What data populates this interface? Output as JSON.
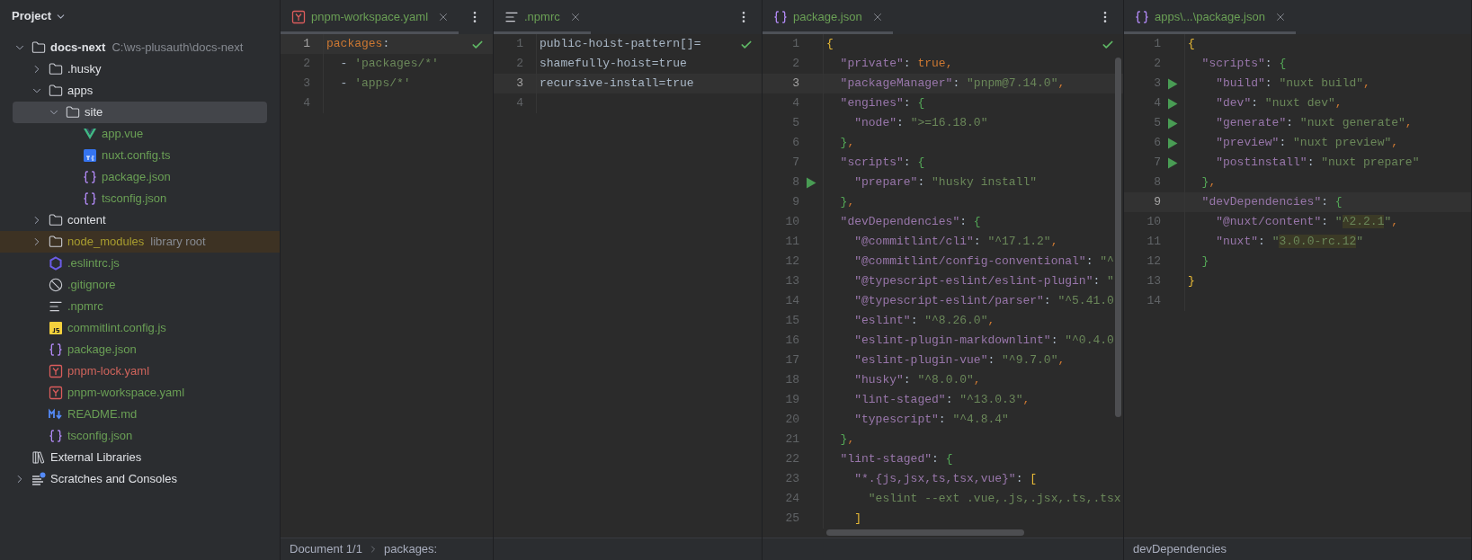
{
  "sidebar": {
    "title": "Project",
    "tree": [
      {
        "label": "docs-next",
        "kind": "folder",
        "bold": true,
        "hint": "C:\\ws-plusauth\\docs-next",
        "expanded": true,
        "selected": false,
        "color": "#dfe1e5",
        "children": [
          {
            "label": ".husky",
            "kind": "folder",
            "expanded": false,
            "selected": false,
            "color": "#dfe1e5"
          },
          {
            "label": "apps",
            "kind": "folder",
            "expanded": true,
            "selected": false,
            "color": "#dfe1e5",
            "children": [
              {
                "label": "site",
                "kind": "folder",
                "expanded": true,
                "selected": true,
                "color": "#dfe1e5",
                "children": [
                  {
                    "label": "app.vue",
                    "kind": "vue",
                    "selected": false,
                    "color": "#6a9f55"
                  },
                  {
                    "label": "nuxt.config.ts",
                    "kind": "ts",
                    "selected": false,
                    "color": "#6a9f55"
                  },
                  {
                    "label": "package.json",
                    "kind": "json",
                    "selected": false,
                    "color": "#6a9f55"
                  },
                  {
                    "label": "tsconfig.json",
                    "kind": "json",
                    "selected": false,
                    "color": "#6a9f55"
                  }
                ]
              }
            ]
          },
          {
            "label": "content",
            "kind": "folder",
            "expanded": false,
            "selected": false,
            "color": "#dfe1e5"
          },
          {
            "label": "node_modules",
            "kind": "library-folder",
            "hint": "library root",
            "expanded": false,
            "selected": false,
            "color": "#a89d2f"
          },
          {
            "label": ".eslintrc.js",
            "kind": "eslint",
            "selected": false,
            "color": "#6a9f55"
          },
          {
            "label": ".gitignore",
            "kind": "ignore",
            "selected": false,
            "color": "#6a9f55"
          },
          {
            "label": ".npmrc",
            "kind": "text",
            "selected": false,
            "color": "#6a9f55"
          },
          {
            "label": "commitlint.config.js",
            "kind": "js",
            "selected": false,
            "color": "#6a9f55"
          },
          {
            "label": "package.json",
            "kind": "json",
            "selected": false,
            "color": "#6a9f55"
          },
          {
            "label": "pnpm-lock.yaml",
            "kind": "yaml",
            "selected": false,
            "color": "#d0645c"
          },
          {
            "label": "pnpm-workspace.yaml",
            "kind": "yaml",
            "selected": false,
            "color": "#6a9f55"
          },
          {
            "label": "README.md",
            "kind": "markdown",
            "selected": false,
            "color": "#6a9f55"
          },
          {
            "label": "tsconfig.json",
            "kind": "json",
            "selected": false,
            "color": "#6a9f55"
          }
        ]
      },
      {
        "label": "External Libraries",
        "kind": "libraries",
        "selected": false,
        "color": "#dfe1e5"
      },
      {
        "label": "Scratches and Consoles",
        "kind": "scratches",
        "expanded": false,
        "selected": false,
        "color": "#dfe1e5"
      }
    ]
  },
  "editors": [
    {
      "tab": {
        "label": "pnpm-workspace.yaml",
        "kind": "yaml",
        "color": "#6a9f55",
        "selected": true
      },
      "menu_button": true,
      "inspection_ok": true,
      "lines": [
        {
          "n": "1",
          "current": true,
          "run": false,
          "tokens": [
            {
              "kind": "ykey",
              "text": "packages"
            },
            {
              "kind": "plain",
              "text": ":"
            }
          ]
        },
        {
          "n": "2",
          "current": false,
          "run": false,
          "tokens": [
            {
              "kind": "plain",
              "text": "  - "
            },
            {
              "kind": "str",
              "text": "'packages/*'"
            }
          ]
        },
        {
          "n": "3",
          "current": false,
          "run": false,
          "tokens": [
            {
              "kind": "plain",
              "text": "  - "
            },
            {
              "kind": "str",
              "text": "'apps/*'"
            }
          ]
        },
        {
          "n": "4",
          "current": false,
          "run": false
        }
      ],
      "breadcrumbs": [
        "Document 1/1",
        "packages:"
      ]
    },
    {
      "tab": {
        "label": ".npmrc",
        "kind": "text",
        "color": "#6a9f55",
        "selected": true
      },
      "menu_button": true,
      "inspection_ok": true,
      "lines": [
        {
          "n": "1",
          "current": false,
          "run": false,
          "tokens": [
            {
              "kind": "plain",
              "text": "public-hoist-pattern[]="
            }
          ]
        },
        {
          "n": "2",
          "current": false,
          "run": false,
          "tokens": [
            {
              "kind": "plain",
              "text": "shamefully-hoist=true"
            }
          ]
        },
        {
          "n": "3",
          "current": true,
          "run": false,
          "tokens": [
            {
              "kind": "plain",
              "text": "recursive-install=true"
            }
          ]
        },
        {
          "n": "4",
          "current": false,
          "run": false
        }
      ]
    },
    {
      "tab": {
        "label": "package.json",
        "kind": "json",
        "color": "#6a9f55",
        "selected": true
      },
      "menu_button": true,
      "inspection_ok": true,
      "lines": [
        {
          "n": "1",
          "current": false,
          "run": false,
          "tokens": [
            {
              "kind": "b1",
              "text": "{"
            }
          ]
        },
        {
          "n": "2",
          "current": false,
          "run": false,
          "tokens": [
            {
              "kind": "key",
              "text": "  \"private\""
            },
            {
              "kind": "plain",
              "text": ": "
            },
            {
              "kind": "kw",
              "text": "true"
            },
            {
              "kind": "kw",
              "text": ","
            }
          ]
        },
        {
          "n": "3",
          "current": true,
          "run": false,
          "tokens": [
            {
              "kind": "key",
              "text": "  \"packageManager\""
            },
            {
              "kind": "plain",
              "text": ": "
            },
            {
              "kind": "str",
              "text": "\"pnpm@7.14.0\""
            },
            {
              "kind": "kw",
              "text": ","
            }
          ]
        },
        {
          "n": "4",
          "current": false,
          "run": false,
          "tokens": [
            {
              "kind": "key",
              "text": "  \"engines\""
            },
            {
              "kind": "plain",
              "text": ": "
            },
            {
              "kind": "b2",
              "text": "{"
            }
          ]
        },
        {
          "n": "5",
          "current": false,
          "run": false,
          "tokens": [
            {
              "kind": "key",
              "text": "    \"node\""
            },
            {
              "kind": "plain",
              "text": ": "
            },
            {
              "kind": "str",
              "text": "\">=16.18.0\""
            }
          ]
        },
        {
          "n": "6",
          "current": false,
          "run": false,
          "tokens": [
            {
              "kind": "b2",
              "text": "  }"
            },
            {
              "kind": "kw",
              "text": ","
            }
          ]
        },
        {
          "n": "7",
          "current": false,
          "run": false,
          "tokens": [
            {
              "kind": "key",
              "text": "  \"scripts\""
            },
            {
              "kind": "plain",
              "text": ": "
            },
            {
              "kind": "b2",
              "text": "{"
            }
          ]
        },
        {
          "n": "8",
          "current": false,
          "run": true,
          "tokens": [
            {
              "kind": "key",
              "text": "    \"prepare\""
            },
            {
              "kind": "plain",
              "text": ": "
            },
            {
              "kind": "str",
              "text": "\"husky install\""
            }
          ]
        },
        {
          "n": "9",
          "current": false,
          "run": false,
          "tokens": [
            {
              "kind": "b2",
              "text": "  }"
            },
            {
              "kind": "kw",
              "text": ","
            }
          ]
        },
        {
          "n": "10",
          "current": false,
          "run": false,
          "tokens": [
            {
              "kind": "key",
              "text": "  \"devDependencies\""
            },
            {
              "kind": "plain",
              "text": ": "
            },
            {
              "kind": "b2",
              "text": "{"
            }
          ]
        },
        {
          "n": "11",
          "current": false,
          "run": false,
          "tokens": [
            {
              "kind": "key",
              "text": "    \"@commitlint/cli\""
            },
            {
              "kind": "plain",
              "text": ": "
            },
            {
              "kind": "str",
              "text": "\"^17.1.2\""
            },
            {
              "kind": "kw",
              "text": ","
            }
          ]
        },
        {
          "n": "12",
          "current": false,
          "run": false,
          "tokens": [
            {
              "kind": "key",
              "text": "    \"@commitlint/config-conventional\""
            },
            {
              "kind": "plain",
              "text": ": "
            },
            {
              "kind": "str",
              "text": "\"^"
            }
          ]
        },
        {
          "n": "13",
          "current": false,
          "run": false,
          "tokens": [
            {
              "kind": "key",
              "text": "    \"@typescript-eslint/eslint-plugin\""
            },
            {
              "kind": "plain",
              "text": ": "
            },
            {
              "kind": "str",
              "text": "\""
            }
          ]
        },
        {
          "n": "14",
          "current": false,
          "run": false,
          "tokens": [
            {
              "kind": "key",
              "text": "    \"@typescript-eslint/parser\""
            },
            {
              "kind": "plain",
              "text": ": "
            },
            {
              "kind": "str",
              "text": "\"^5.41.0"
            }
          ]
        },
        {
          "n": "15",
          "current": false,
          "run": false,
          "tokens": [
            {
              "kind": "key",
              "text": "    \"eslint\""
            },
            {
              "kind": "plain",
              "text": ": "
            },
            {
              "kind": "str",
              "text": "\"^8.26.0\""
            },
            {
              "kind": "kw",
              "text": ","
            }
          ]
        },
        {
          "n": "16",
          "current": false,
          "run": false,
          "tokens": [
            {
              "kind": "key",
              "text": "    \"eslint-plugin-markdownlint\""
            },
            {
              "kind": "plain",
              "text": ": "
            },
            {
              "kind": "str",
              "text": "\"^0.4.0"
            }
          ]
        },
        {
          "n": "17",
          "current": false,
          "run": false,
          "tokens": [
            {
              "kind": "key",
              "text": "    \"eslint-plugin-vue\""
            },
            {
              "kind": "plain",
              "text": ": "
            },
            {
              "kind": "str",
              "text": "\"^9.7.0\""
            },
            {
              "kind": "kw",
              "text": ","
            }
          ]
        },
        {
          "n": "18",
          "current": false,
          "run": false,
          "tokens": [
            {
              "kind": "key",
              "text": "    \"husky\""
            },
            {
              "kind": "plain",
              "text": ": "
            },
            {
              "kind": "str",
              "text": "\"^8.0.0\""
            },
            {
              "kind": "kw",
              "text": ","
            }
          ]
        },
        {
          "n": "19",
          "current": false,
          "run": false,
          "tokens": [
            {
              "kind": "key",
              "text": "    \"lint-staged\""
            },
            {
              "kind": "plain",
              "text": ": "
            },
            {
              "kind": "str",
              "text": "\"^13.0.3\""
            },
            {
              "kind": "kw",
              "text": ","
            }
          ]
        },
        {
          "n": "20",
          "current": false,
          "run": false,
          "tokens": [
            {
              "kind": "key",
              "text": "    \"typescript\""
            },
            {
              "kind": "plain",
              "text": ": "
            },
            {
              "kind": "str",
              "text": "\"^4.8.4\""
            }
          ]
        },
        {
          "n": "21",
          "current": false,
          "run": false,
          "tokens": [
            {
              "kind": "b2",
              "text": "  }"
            },
            {
              "kind": "kw",
              "text": ","
            }
          ]
        },
        {
          "n": "22",
          "current": false,
          "run": false,
          "tokens": [
            {
              "kind": "key",
              "text": "  \"lint-staged\""
            },
            {
              "kind": "plain",
              "text": ": "
            },
            {
              "kind": "b2",
              "text": "{"
            }
          ]
        },
        {
          "n": "23",
          "current": false,
          "run": false,
          "tokens": [
            {
              "kind": "key",
              "text": "    \"*.{js,jsx,ts,tsx,vue}\""
            },
            {
              "kind": "plain",
              "text": ": "
            },
            {
              "kind": "b1",
              "text": "["
            }
          ]
        },
        {
          "n": "24",
          "current": false,
          "run": false,
          "tokens": [
            {
              "kind": "str",
              "text": "      \"eslint --ext .vue,.js,.jsx,.ts,.tsx"
            }
          ]
        },
        {
          "n": "25",
          "current": false,
          "run": false,
          "tokens": [
            {
              "kind": "b1",
              "text": "    ]"
            }
          ]
        }
      ]
    },
    {
      "tab": {
        "label": "apps\\...\\package.json",
        "kind": "json",
        "color": "#6a9f55",
        "selected": true
      },
      "menu_button": false,
      "inspection_ok": false,
      "lines": [
        {
          "n": "1",
          "current": false,
          "run": false,
          "tokens": [
            {
              "kind": "b1",
              "text": "{"
            }
          ]
        },
        {
          "n": "2",
          "current": false,
          "run": false,
          "tokens": [
            {
              "kind": "key",
              "text": "  \"scripts\""
            },
            {
              "kind": "plain",
              "text": ": "
            },
            {
              "kind": "b2",
              "text": "{"
            }
          ]
        },
        {
          "n": "3",
          "current": false,
          "run": true,
          "tokens": [
            {
              "kind": "key",
              "text": "    \"build\""
            },
            {
              "kind": "plain",
              "text": ": "
            },
            {
              "kind": "str",
              "text": "\"nuxt build\""
            },
            {
              "kind": "kw",
              "text": ","
            }
          ]
        },
        {
          "n": "4",
          "current": false,
          "run": true,
          "tokens": [
            {
              "kind": "key",
              "text": "    \"dev\""
            },
            {
              "kind": "plain",
              "text": ": "
            },
            {
              "kind": "str",
              "text": "\"nuxt dev\""
            },
            {
              "kind": "kw",
              "text": ","
            }
          ]
        },
        {
          "n": "5",
          "current": false,
          "run": true,
          "tokens": [
            {
              "kind": "key",
              "text": "    \"generate\""
            },
            {
              "kind": "plain",
              "text": ": "
            },
            {
              "kind": "str",
              "text": "\"nuxt generate\""
            },
            {
              "kind": "kw",
              "text": ","
            }
          ]
        },
        {
          "n": "6",
          "current": false,
          "run": true,
          "tokens": [
            {
              "kind": "key",
              "text": "    \"preview\""
            },
            {
              "kind": "plain",
              "text": ": "
            },
            {
              "kind": "str",
              "text": "\"nuxt preview\""
            },
            {
              "kind": "kw",
              "text": ","
            }
          ]
        },
        {
          "n": "7",
          "current": false,
          "run": true,
          "tokens": [
            {
              "kind": "key",
              "text": "    \"postinstall\""
            },
            {
              "kind": "plain",
              "text": ": "
            },
            {
              "kind": "str",
              "text": "\"nuxt prepare\""
            }
          ]
        },
        {
          "n": "8",
          "current": false,
          "run": false,
          "tokens": [
            {
              "kind": "b2",
              "text": "  }"
            },
            {
              "kind": "kw",
              "text": ","
            }
          ]
        },
        {
          "n": "9",
          "current": true,
          "run": false,
          "tokens": [
            {
              "kind": "key",
              "text": "  \"devDependencies\""
            },
            {
              "kind": "plain",
              "text": ": "
            },
            {
              "kind": "b2",
              "text": "{"
            }
          ]
        },
        {
          "n": "10",
          "current": false,
          "run": false,
          "tokens": [
            {
              "kind": "key",
              "text": "    \"@nuxt/content\""
            },
            {
              "kind": "plain",
              "text": ": "
            },
            {
              "kind": "str",
              "text": "\""
            },
            {
              "kind": "hl",
              "text": "^2.2.1"
            },
            {
              "kind": "str",
              "text": "\""
            },
            {
              "kind": "kw",
              "text": ","
            }
          ]
        },
        {
          "n": "11",
          "current": false,
          "run": false,
          "tokens": [
            {
              "kind": "key",
              "text": "    \"nuxt\""
            },
            {
              "kind": "plain",
              "text": ": "
            },
            {
              "kind": "str",
              "text": "\""
            },
            {
              "kind": "hl",
              "text": "3.0.0-rc.12"
            },
            {
              "kind": "str",
              "text": "\""
            }
          ]
        },
        {
          "n": "12",
          "current": false,
          "run": false,
          "tokens": [
            {
              "kind": "b2",
              "text": "  }"
            }
          ]
        },
        {
          "n": "13",
          "current": false,
          "run": false,
          "tokens": [
            {
              "kind": "b1",
              "text": "}"
            }
          ]
        },
        {
          "n": "14",
          "current": false,
          "run": false
        }
      ],
      "breadcrumbs": [
        "devDependencies"
      ]
    }
  ]
}
